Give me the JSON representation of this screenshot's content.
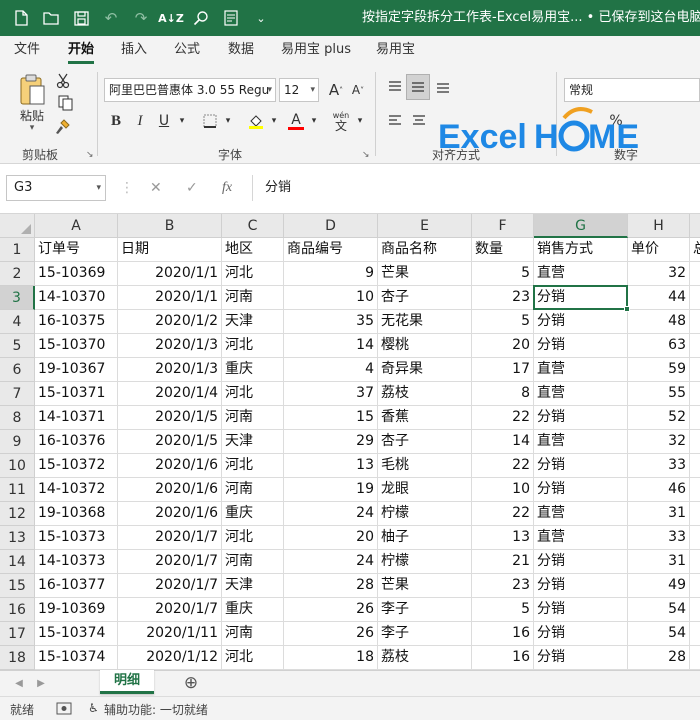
{
  "titlebar": {
    "title": "按指定字段拆分工作表-Excel易用宝... • 已保存到这台电脑 ▾",
    "qat_icons": [
      "new-file-icon",
      "open-folder-icon",
      "save-icon",
      "undo-icon",
      "redo-icon",
      "sort-az-icon",
      "find-icon",
      "form-icon",
      "customize-qat-icon"
    ]
  },
  "ribbon_tabs": [
    "文件",
    "开始",
    "插入",
    "公式",
    "数据",
    "易用宝 plus",
    "易用宝"
  ],
  "active_tab": "开始",
  "ribbon": {
    "paste_label": "粘贴",
    "clipboard_label": "剪贴板",
    "font_name": "阿里巴巴普惠体 3.0 55 Regu",
    "font_size": "12",
    "font_group_label": "字体",
    "align_group_label": "对齐方式",
    "number_format": "常规",
    "number_group_label": "数字",
    "bold_label": "B",
    "italic_label": "I",
    "underline_label": "U",
    "font_color_letter": "A",
    "phonetic_label": "wén",
    "phonetic_char": "文",
    "font_color": "#ff0000",
    "fill_color": "#ffff00"
  },
  "watermark": {
    "text_excel": "Excel",
    "text_home": "HOME"
  },
  "formula_bar": {
    "name_box": "G3",
    "cancel_glyph": "✕",
    "enter_glyph": "✓",
    "fx_label": "fx",
    "formula": "分销"
  },
  "sheet": {
    "columns": [
      "A",
      "B",
      "C",
      "D",
      "E",
      "F",
      "G",
      "H",
      ""
    ],
    "row_numbers": [
      "1",
      "2",
      "3",
      "4",
      "5",
      "6",
      "7",
      "8",
      "9",
      "10",
      "11",
      "12",
      "13",
      "14",
      "15",
      "16",
      "17",
      "18"
    ],
    "header_row": [
      "订单号",
      "日期",
      "地区",
      "商品编号",
      "商品名称",
      "数量",
      "销售方式",
      "单价",
      "总"
    ],
    "rows": [
      [
        "15-10369",
        "2020/1/1",
        "河北",
        "9",
        "芒果",
        "5",
        "直营",
        "32"
      ],
      [
        "14-10370",
        "2020/1/1",
        "河南",
        "10",
        "杏子",
        "23",
        "分销",
        "44"
      ],
      [
        "16-10375",
        "2020/1/2",
        "天津",
        "35",
        "无花果",
        "5",
        "分销",
        "48"
      ],
      [
        "15-10370",
        "2020/1/3",
        "河北",
        "14",
        "樱桃",
        "20",
        "分销",
        "63"
      ],
      [
        "19-10367",
        "2020/1/3",
        "重庆",
        "4",
        "奇异果",
        "17",
        "直营",
        "59"
      ],
      [
        "15-10371",
        "2020/1/4",
        "河北",
        "37",
        "荔枝",
        "8",
        "直营",
        "55"
      ],
      [
        "14-10371",
        "2020/1/5",
        "河南",
        "15",
        "香蕉",
        "22",
        "分销",
        "52"
      ],
      [
        "16-10376",
        "2020/1/5",
        "天津",
        "29",
        "杏子",
        "14",
        "直营",
        "32"
      ],
      [
        "15-10372",
        "2020/1/6",
        "河北",
        "13",
        "毛桃",
        "22",
        "分销",
        "33"
      ],
      [
        "14-10372",
        "2020/1/6",
        "河南",
        "19",
        "龙眼",
        "10",
        "分销",
        "46"
      ],
      [
        "19-10368",
        "2020/1/6",
        "重庆",
        "24",
        "柠檬",
        "22",
        "直营",
        "31"
      ],
      [
        "15-10373",
        "2020/1/7",
        "河北",
        "20",
        "柚子",
        "13",
        "直营",
        "33"
      ],
      [
        "14-10373",
        "2020/1/7",
        "河南",
        "24",
        "柠檬",
        "21",
        "分销",
        "31"
      ],
      [
        "16-10377",
        "2020/1/7",
        "天津",
        "28",
        "芒果",
        "23",
        "分销",
        "49"
      ],
      [
        "19-10369",
        "2020/1/7",
        "重庆",
        "26",
        "李子",
        "5",
        "分销",
        "54"
      ],
      [
        "15-10374",
        "2020/1/11",
        "河南",
        "26",
        "李子",
        "16",
        "分销",
        "54"
      ],
      [
        "15-10374",
        "2020/1/12",
        "河北",
        "18",
        "荔枝",
        "16",
        "分销",
        "28"
      ]
    ],
    "active_cell": "G3"
  },
  "sheet_tabs": {
    "active": "明细",
    "add_glyph": "⊕"
  },
  "status_bar": {
    "ready": "就绪",
    "accessibility": "辅助功能: 一切就绪"
  },
  "colors": {
    "accent": "#217346",
    "watermark_blue": "#1e88e5",
    "watermark_orange": "#f0a020"
  }
}
